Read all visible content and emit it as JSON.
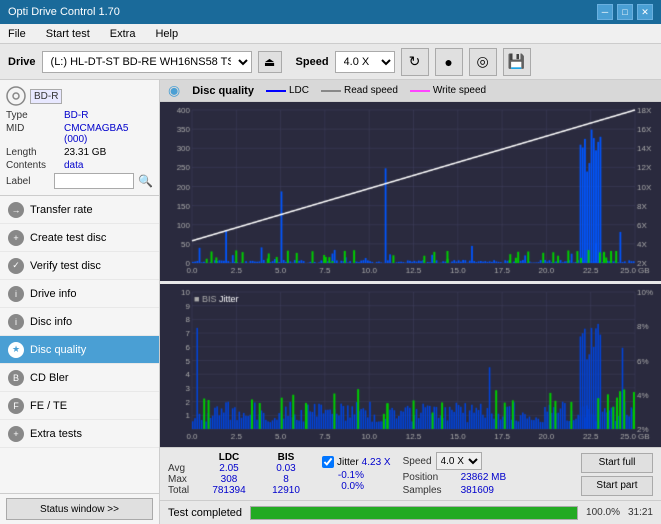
{
  "titlebar": {
    "title": "Opti Drive Control 1.70",
    "minimize": "─",
    "maximize": "□",
    "close": "✕"
  },
  "menubar": {
    "items": [
      "File",
      "Start test",
      "Extra",
      "Help"
    ]
  },
  "drivebar": {
    "label": "Drive",
    "drive_value": "(L:)  HL-DT-ST BD-RE  WH16NS58 TST4",
    "eject_icon": "⏏",
    "speed_label": "Speed",
    "speed_value": "4.0 X",
    "icon1": "↻",
    "icon2": "●",
    "icon3": "◎",
    "icon4": "💾"
  },
  "disc_panel": {
    "type_label": "Type",
    "type_val": "BD-R",
    "mid_label": "MID",
    "mid_val": "CMCMAGBA5 (000)",
    "length_label": "Length",
    "length_val": "23.31 GB",
    "contents_label": "Contents",
    "contents_val": "data",
    "label_label": "Label",
    "label_val": ""
  },
  "nav": {
    "items": [
      {
        "id": "transfer-rate",
        "label": "Transfer rate",
        "active": false
      },
      {
        "id": "create-test-disc",
        "label": "Create test disc",
        "active": false
      },
      {
        "id": "verify-test-disc",
        "label": "Verify test disc",
        "active": false
      },
      {
        "id": "drive-info",
        "label": "Drive info",
        "active": false
      },
      {
        "id": "disc-info",
        "label": "Disc info",
        "active": false
      },
      {
        "id": "disc-quality",
        "label": "Disc quality",
        "active": true
      },
      {
        "id": "cd-bler",
        "label": "CD Bler",
        "active": false
      },
      {
        "id": "fe-te",
        "label": "FE / TE",
        "active": false
      },
      {
        "id": "extra-tests",
        "label": "Extra tests",
        "active": false
      }
    ]
  },
  "status": {
    "btn_label": "Status window >>"
  },
  "dq_header": {
    "title": "Disc quality",
    "legend": [
      {
        "label": "LDC",
        "color": "#0000ff"
      },
      {
        "label": "Read speed",
        "color": "#ffffff"
      },
      {
        "label": "Write speed",
        "color": "#ff00ff"
      }
    ]
  },
  "chart_top": {
    "y_left": [
      "400",
      "350",
      "300",
      "250",
      "200",
      "150",
      "100",
      "50",
      "0"
    ],
    "y_right": [
      "18X",
      "16X",
      "14X",
      "12X",
      "10X",
      "8X",
      "6X",
      "4X",
      "2X"
    ],
    "x_labels": [
      "0.0",
      "2.5",
      "5.0",
      "7.5",
      "10.0",
      "12.5",
      "15.0",
      "17.5",
      "20.0",
      "22.5",
      "25.0 GB"
    ]
  },
  "chart_bottom": {
    "title_bis": "BIS",
    "title_jitter": "Jitter",
    "y_left": [
      "10",
      "9",
      "8",
      "7",
      "6",
      "5",
      "4",
      "3",
      "2",
      "1"
    ],
    "y_right": [
      "10%",
      "8%",
      "6%",
      "4%",
      "2%"
    ],
    "x_labels": [
      "0.0",
      "2.5",
      "5.0",
      "7.5",
      "10.0",
      "12.5",
      "15.0",
      "17.5",
      "20.0",
      "22.5",
      "25.0 GB"
    ]
  },
  "stats": {
    "col_headers": [
      "LDC",
      "BIS",
      "",
      "Jitter",
      "Speed"
    ],
    "rows": [
      {
        "label": "Avg",
        "ldc": "2.05",
        "bis": "0.03",
        "jitter": "-0.1%",
        "speed_label": "Position",
        "speed_val": "23862 MB"
      },
      {
        "label": "Max",
        "ldc": "308",
        "bis": "8",
        "jitter": "0.0%",
        "speed_label": "Samples",
        "speed_val": "381609"
      },
      {
        "label": "Total",
        "ldc": "781394",
        "bis": "12910",
        "jitter": ""
      }
    ],
    "speed_display": "4.23 X",
    "speed_select": "4.0 X",
    "jitter_checked": true,
    "btn_start_full": "Start full",
    "btn_start_part": "Start part"
  },
  "progress": {
    "bar_pct": 100,
    "pct_text": "100.0%",
    "status_text": "Test completed",
    "time_text": "31:21"
  }
}
